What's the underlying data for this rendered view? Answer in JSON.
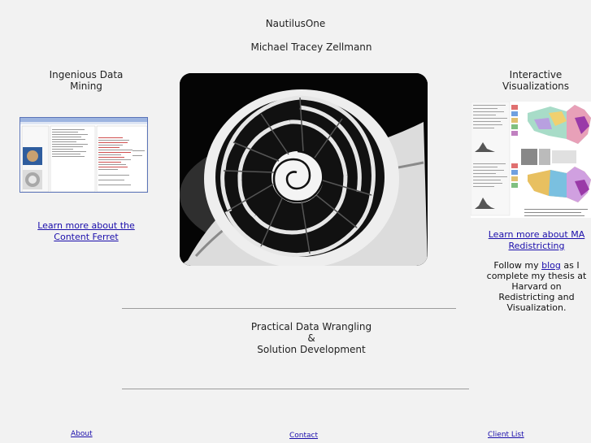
{
  "header": {
    "site_title": "NautilusOne",
    "author": "Michael Tracey Zellmann"
  },
  "left_column": {
    "title": "Ingenious Data Mining",
    "link": "Learn more about the Content Ferret"
  },
  "right_column": {
    "title": "Interactive Visualizations",
    "link": "Learn more about MA Redistricting",
    "blog_prefix": "Follow my ",
    "blog_link": "blog",
    "blog_suffix": " as I complete my thesis at Harvard on Redistricting and Visualization."
  },
  "tagline": {
    "line1": "Practical Data Wrangling",
    "line2": "&",
    "line3": "Solution Development"
  },
  "footer": {
    "about": "About",
    "contact": "Contact",
    "client_list": "Client List"
  },
  "colors": {
    "background": "#f2f2f2",
    "link": "#1a0dab"
  }
}
